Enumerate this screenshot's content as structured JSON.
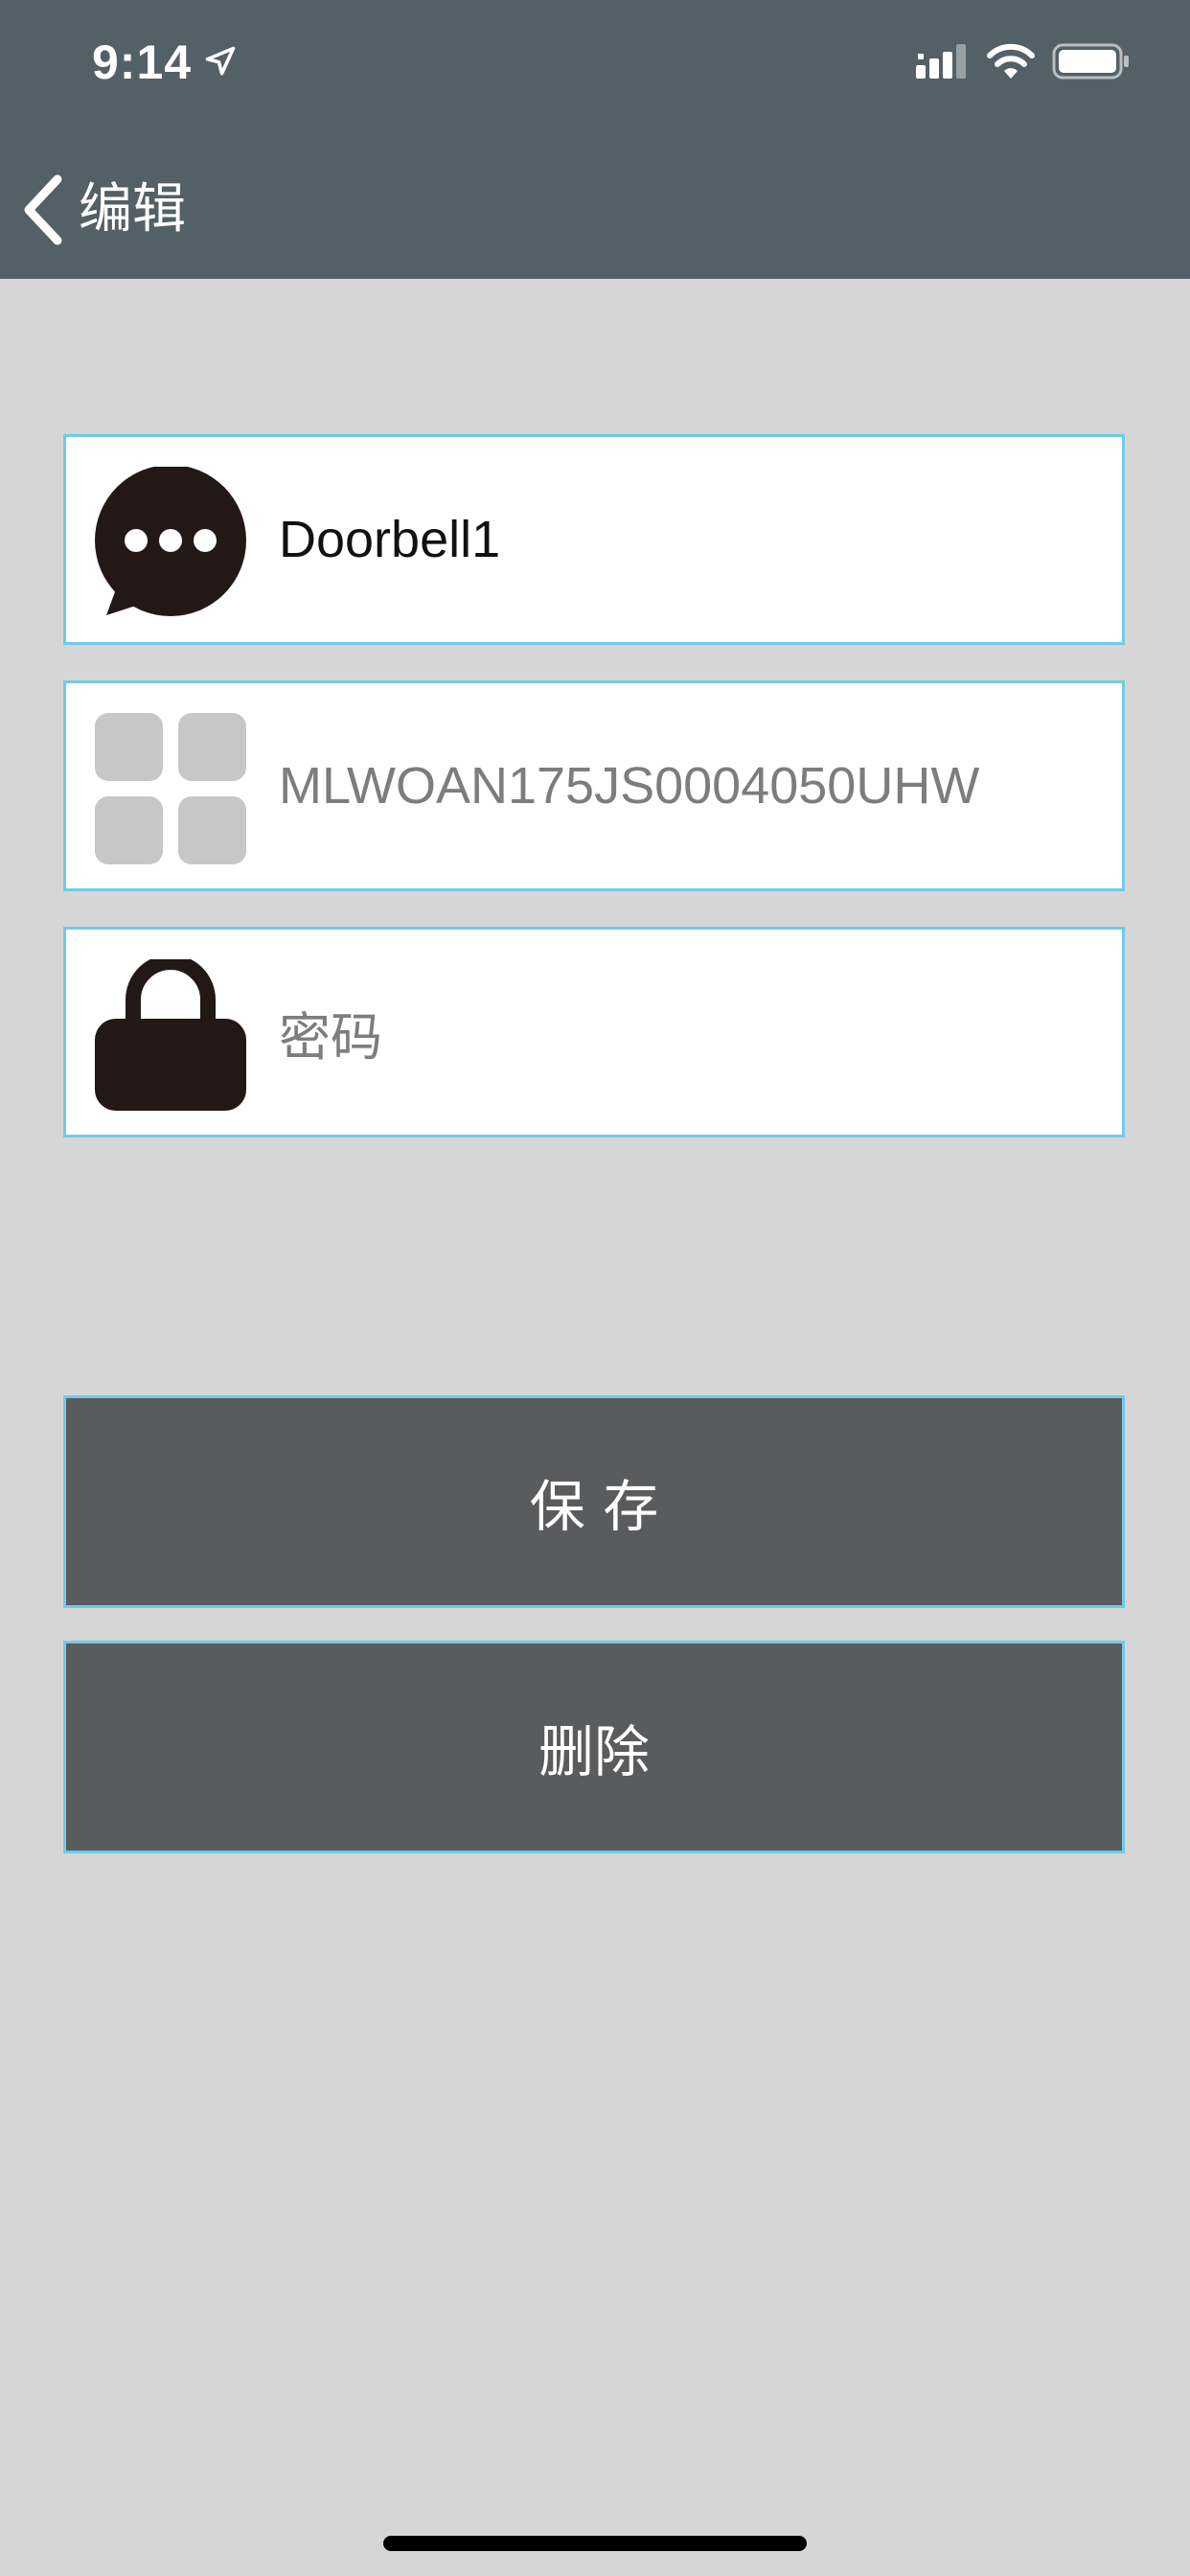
{
  "status_bar": {
    "time": "9:14",
    "icons": [
      "location-arrow-icon",
      "cellular-signal-icon",
      "wifi-icon",
      "battery-icon"
    ]
  },
  "nav": {
    "back_label": "编辑",
    "back_icon": "chevron-left-icon"
  },
  "form": {
    "name_field": {
      "icon": "chat-bubble-icon",
      "value": "Doorbell1"
    },
    "device_id_field": {
      "icon": "grid-icon",
      "value": "MLWOAN175JS0004050UHW"
    },
    "password_field": {
      "icon": "lock-icon",
      "placeholder": "密码"
    }
  },
  "actions": {
    "save_label": "保 存",
    "delete_label": "删除"
  },
  "colors": {
    "header_bg": "#536067",
    "page_bg": "#d6d6d6",
    "field_border": "#6fcbe9",
    "button_bg": "#5a5b5d",
    "icon_dark": "#231815",
    "icon_gray": "#c7c7c7"
  }
}
